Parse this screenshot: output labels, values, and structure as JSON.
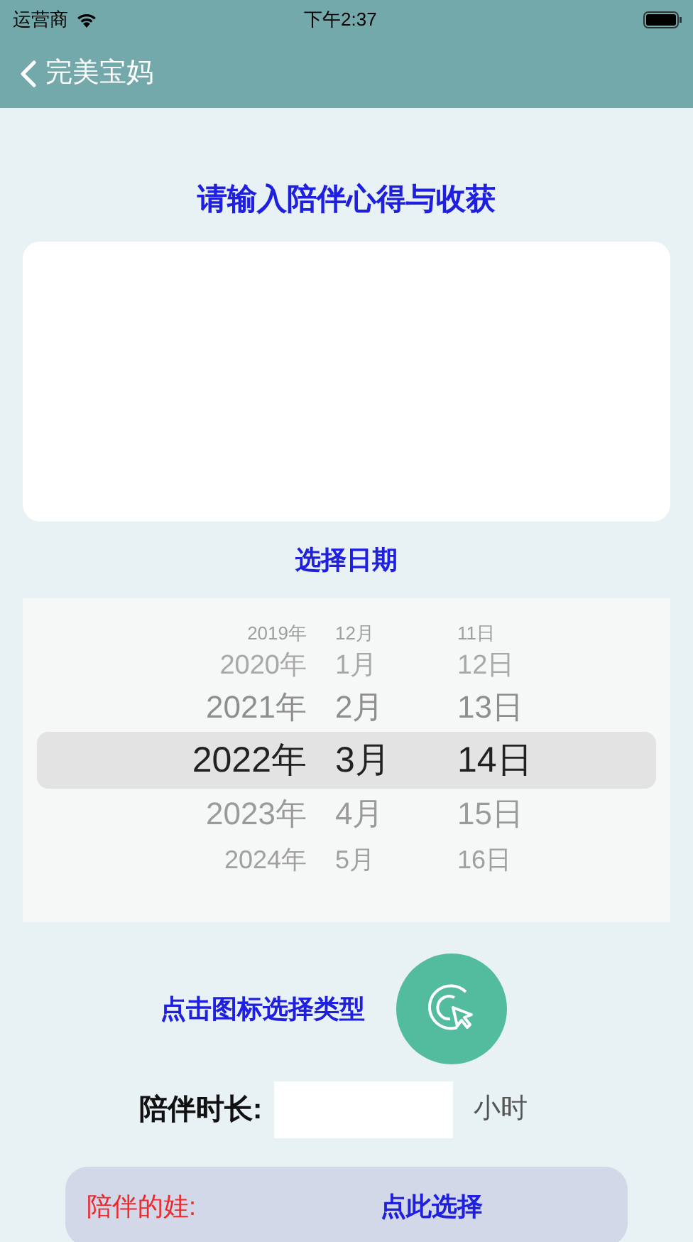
{
  "status_bar": {
    "carrier": "运营商",
    "time": "下午2:37"
  },
  "nav": {
    "back_title": "完美宝妈"
  },
  "prompt": "请输入陪伴心得与收获",
  "date_label": "选择日期",
  "date_picker": {
    "rows": [
      {
        "year": "2019年",
        "month": "12月",
        "day": "11日",
        "selected": false
      },
      {
        "year": "2020年",
        "month": "1月",
        "day": "12日",
        "selected": false
      },
      {
        "year": "2021年",
        "month": "2月",
        "day": "13日",
        "selected": false
      },
      {
        "year": "2022年",
        "month": "3月",
        "day": "14日",
        "selected": true
      },
      {
        "year": "2023年",
        "month": "4月",
        "day": "15日",
        "selected": false
      },
      {
        "year": "2024年",
        "month": "5月",
        "day": "16日",
        "selected": false
      }
    ]
  },
  "type_hint": "点击图标选择类型",
  "duration": {
    "label": "陪伴时长:",
    "unit": "小时"
  },
  "child_picker": {
    "label": "陪伴的娃:",
    "action": "点此选择"
  }
}
